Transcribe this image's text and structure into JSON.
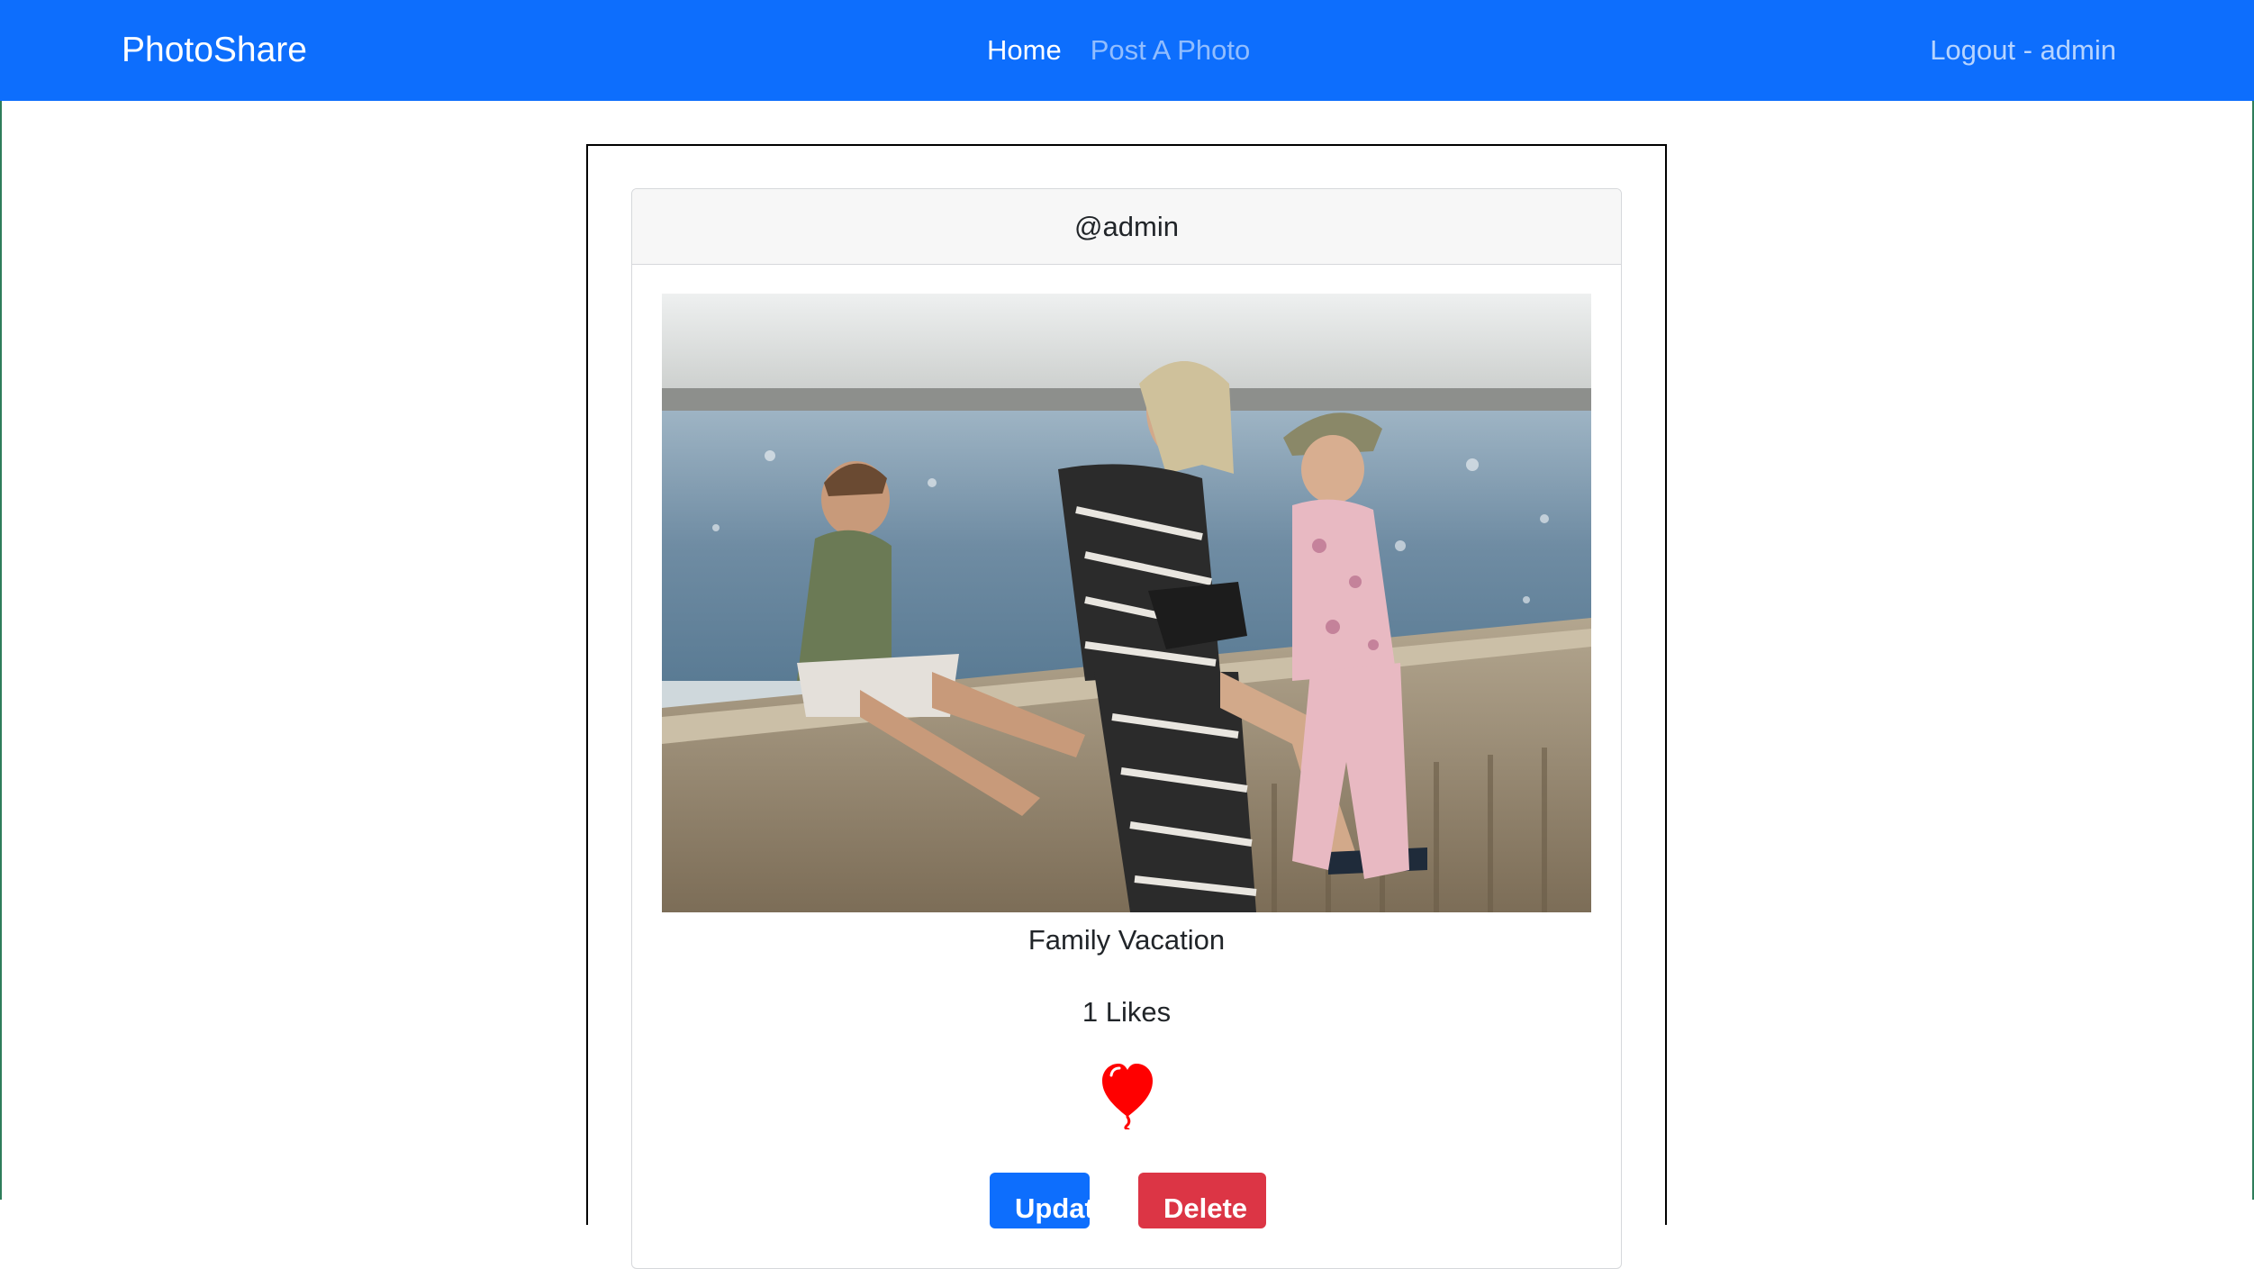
{
  "navbar": {
    "brand": "PhotoShare",
    "links": [
      {
        "label": "Home",
        "active": true
      },
      {
        "label": "Post A Photo",
        "active": false
      }
    ],
    "right_link": "Logout - admin"
  },
  "post": {
    "username": "@admin",
    "caption": "Family Vacation",
    "likes_text": "1 Likes",
    "photo_alt": "Family Vacation",
    "update_label": "Update",
    "delete_label": "Delete"
  },
  "colors": {
    "navbar": "#0d6efd",
    "heart": "#ff0000",
    "update_button": "#0d6efd",
    "delete_button": "#dc3545"
  },
  "icons": {
    "like": "heart-icon"
  }
}
